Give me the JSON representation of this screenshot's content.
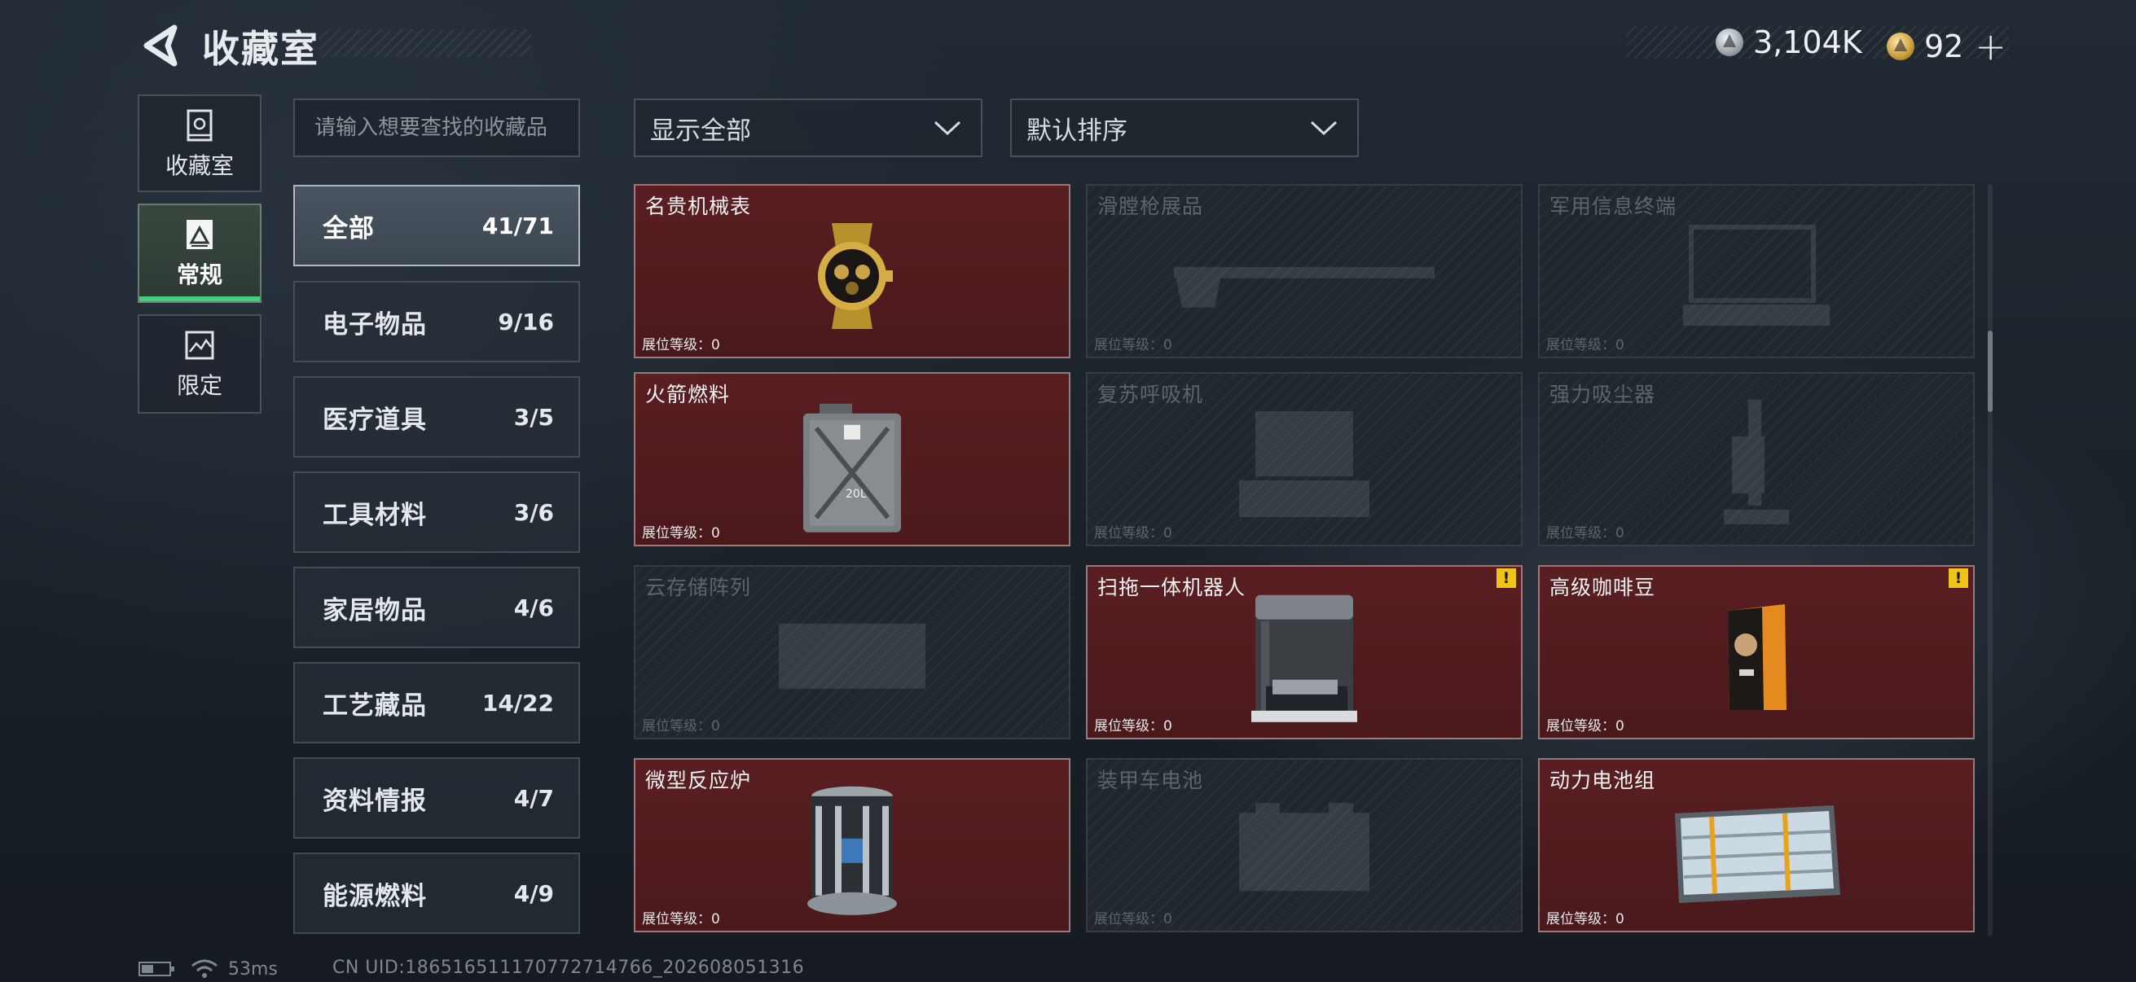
{
  "header": {
    "title": "收藏室",
    "currency": [
      {
        "icon": "silver-coin-icon",
        "value": "3,104K"
      },
      {
        "icon": "gold-coin-icon",
        "value": "92"
      }
    ],
    "add_icon": "plus-icon"
  },
  "nav": [
    {
      "label": "收藏室",
      "icon": "collection-room-icon",
      "active": false
    },
    {
      "label": "常规",
      "icon": "regular-icon",
      "active": true
    },
    {
      "label": "限定",
      "icon": "limited-icon",
      "active": false
    }
  ],
  "search": {
    "placeholder": "请输入想要查找的收藏品",
    "value": ""
  },
  "categories": [
    {
      "name": "全部",
      "count": "41/71",
      "active": true
    },
    {
      "name": "电子物品",
      "count": "9/16"
    },
    {
      "name": "医疗道具",
      "count": "3/5"
    },
    {
      "name": "工具材料",
      "count": "3/6"
    },
    {
      "name": "家居物品",
      "count": "4/6"
    },
    {
      "name": "工艺藏品",
      "count": "14/22"
    },
    {
      "name": "资料情报",
      "count": "4/7"
    },
    {
      "name": "能源燃料",
      "count": "4/9"
    }
  ],
  "filters": {
    "show": "显示全部",
    "sort": "默认排序"
  },
  "items": [
    {
      "name": "名贵机械表",
      "level_label": "展位等级：",
      "level": "0",
      "owned": true,
      "warning": false,
      "icon": "watch-icon"
    },
    {
      "name": "滑膛枪展品",
      "level_label": "展位等级：",
      "level": "0",
      "owned": false,
      "warning": false,
      "icon": "musket-icon"
    },
    {
      "name": "军用信息终端",
      "level_label": "展位等级：",
      "level": "0",
      "owned": false,
      "warning": false,
      "icon": "terminal-icon"
    },
    {
      "name": "火箭燃料",
      "level_label": "展位等级：",
      "level": "0",
      "owned": true,
      "warning": false,
      "icon": "fuel-can-icon"
    },
    {
      "name": "复苏呼吸机",
      "level_label": "展位等级：",
      "level": "0",
      "owned": false,
      "warning": false,
      "icon": "ventilator-icon"
    },
    {
      "name": "强力吸尘器",
      "level_label": "展位等级：",
      "level": "0",
      "owned": false,
      "warning": false,
      "icon": "vacuum-icon"
    },
    {
      "name": "云存储阵列",
      "level_label": "展位等级：",
      "level": "0",
      "owned": false,
      "warning": false,
      "icon": "storage-array-icon"
    },
    {
      "name": "扫拖一体机器人",
      "level_label": "展位等级：",
      "level": "0",
      "owned": true,
      "warning": true,
      "icon": "robot-station-icon"
    },
    {
      "name": "高级咖啡豆",
      "level_label": "展位等级：",
      "level": "0",
      "owned": true,
      "warning": true,
      "icon": "coffee-bag-icon"
    },
    {
      "name": "微型反应炉",
      "level_label": "展位等级：",
      "level": "0",
      "owned": true,
      "warning": false,
      "icon": "reactor-icon"
    },
    {
      "name": "装甲车电池",
      "level_label": "展位等级：",
      "level": "0",
      "owned": false,
      "warning": false,
      "icon": "battery-icon"
    },
    {
      "name": "动力电池组",
      "level_label": "展位等级：",
      "level": "0",
      "owned": true,
      "warning": false,
      "icon": "battery-pack-icon"
    }
  ],
  "footer": {
    "ping": "53ms",
    "uid": "CN UID:186516511170772714766_202608051316"
  },
  "colors": {
    "owned_card": "#4f1b1f",
    "active_nav_bar": "#3fd07a",
    "warning": "#f0c419"
  }
}
